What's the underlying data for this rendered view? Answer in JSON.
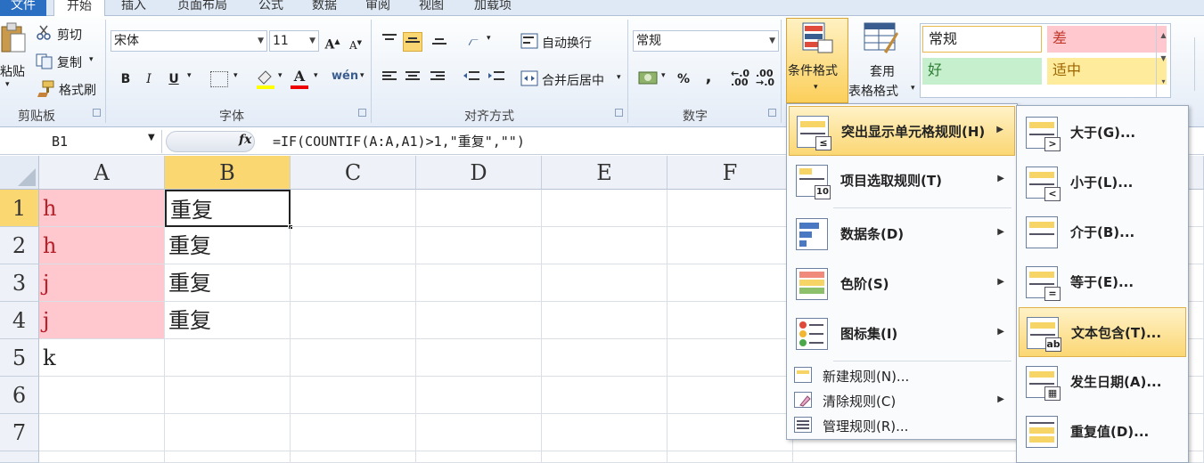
{
  "tabs": [
    "文件",
    "开始",
    "插入",
    "页面布局",
    "公式",
    "数据",
    "审阅",
    "视图",
    "加载项"
  ],
  "clipboard": {
    "paste": "粘贴",
    "cut": "剪切",
    "copy": "复制",
    "format_painter": "格式刷",
    "group": "剪贴板"
  },
  "font": {
    "name": "宋体",
    "size": "11",
    "group": "字体",
    "bold": "B",
    "italic": "I",
    "underline": "U"
  },
  "alignment": {
    "wrap": "自动换行",
    "merge": "合并后居中",
    "group": "对齐方式"
  },
  "number": {
    "format": "常规",
    "percent": "%",
    "comma": ",",
    "group": "数字"
  },
  "styles_group": {
    "conditional": "条件格式",
    "table_l1": "套用",
    "table_l2": "表格格式"
  },
  "cell_styles": [
    {
      "label": "常规",
      "color": "#ffffff",
      "text": "#222222"
    },
    {
      "label": "差",
      "color": "#ffc7ce",
      "text": "#c0392b"
    },
    {
      "label": "好",
      "color": "#c6efce",
      "text": "#2e7d32"
    },
    {
      "label": "适中",
      "color": "#ffeb9c",
      "text": "#9c6500"
    }
  ],
  "formula_bar": {
    "name_box": "B1",
    "fx": "fx",
    "formula": "=IF(COUNTIF(A:A,A1)>1,\"重复\",\"\")"
  },
  "columns": [
    "A",
    "B",
    "C",
    "D",
    "E",
    "F"
  ],
  "rows": [
    "1",
    "2",
    "3",
    "4",
    "5",
    "6",
    "7"
  ],
  "cells": {
    "A": [
      "h",
      "h",
      "j",
      "j",
      "k",
      "",
      ""
    ],
    "B": [
      "重复",
      "重复",
      "重复",
      "重复",
      "",
      "",
      ""
    ]
  },
  "menu_main": [
    {
      "label": "突出显示单元格规则(H)",
      "arrow": "▶"
    },
    {
      "label": "项目选取规则(T)",
      "arrow": "▶"
    },
    {
      "label": "数据条(D)",
      "arrow": "▶"
    },
    {
      "label": "色阶(S)",
      "arrow": "▶"
    },
    {
      "label": "图标集(I)",
      "arrow": "▶"
    }
  ],
  "menu_small": [
    {
      "label": "新建规则(N)...",
      "arrow": ""
    },
    {
      "label": "清除规则(C)",
      "arrow": "▶"
    },
    {
      "label": "管理规则(R)...",
      "arrow": ""
    }
  ],
  "menu_sub": [
    {
      "label": "大于(G)...",
      "sym": ">"
    },
    {
      "label": "小于(L)...",
      "sym": "<"
    },
    {
      "label": "介于(B)...",
      "sym": ""
    },
    {
      "label": "等于(E)...",
      "sym": "="
    },
    {
      "label": "文本包含(T)...",
      "sym": "ab"
    },
    {
      "label": "发生日期(A)...",
      "sym": "▦"
    },
    {
      "label": "重复值(D)...",
      "sym": ""
    }
  ]
}
